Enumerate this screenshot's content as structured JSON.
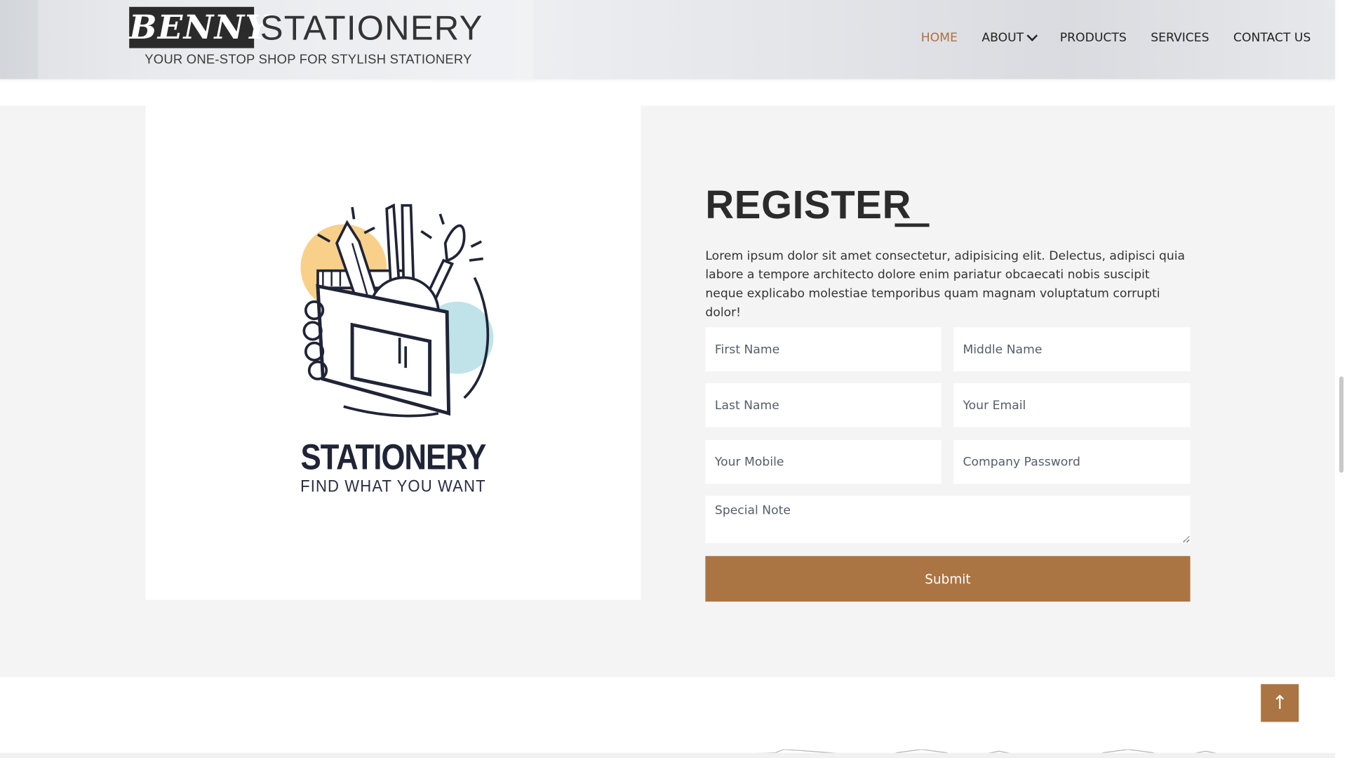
{
  "header": {
    "logo_box_text": "BENNY",
    "logo_word": "STATIONERY",
    "tagline": "YOUR ONE-STOP SHOP FOR STYLISH STATIONERY",
    "nav": [
      {
        "label": "HOME",
        "active": true
      },
      {
        "label": "ABOUT",
        "has_dropdown": true
      },
      {
        "label": "PRODUCTS"
      },
      {
        "label": "SERVICES"
      },
      {
        "label": "CONTACT US"
      }
    ]
  },
  "illustration": {
    "title": "STATIONERY",
    "subtitle": "FIND WHAT YOU WANT"
  },
  "register": {
    "title": "REGISTER",
    "description": "Lorem ipsum dolor sit amet consectetur, adipisicing elit. Delectus, adipisci quia labore a tempore architecto dolore enim pariatur obcaecati nobis suscipit neque explicabo molestiae temporibus quam magnam voluptatum corrupti dolor!",
    "fields": {
      "first_name": "First Name",
      "middle_name": "Middle Name",
      "last_name": "Last Name",
      "email": "Your Email",
      "mobile": "Your Mobile",
      "password": "Company Password",
      "note": "Special Note"
    },
    "submit_label": "Submit"
  },
  "back_to_top": "↑",
  "colors": {
    "accent": "#ab7443",
    "nav_active": "#b0703c",
    "section_bg": "#f4f4f4",
    "heading": "#2b2b2b"
  }
}
